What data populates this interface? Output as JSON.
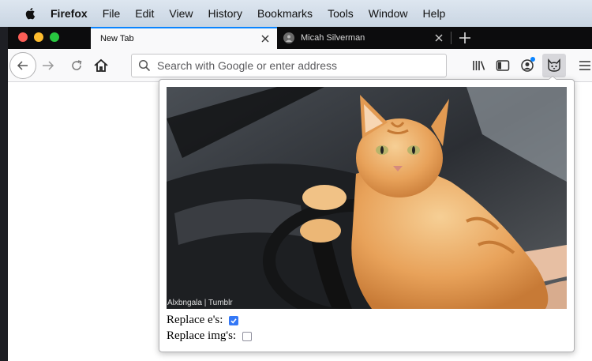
{
  "menubar": {
    "app_name": "Firefox",
    "items": [
      "File",
      "Edit",
      "View",
      "History",
      "Bookmarks",
      "Tools",
      "Window",
      "Help"
    ]
  },
  "tabs": [
    {
      "title": "New Tab",
      "active": true
    },
    {
      "title": "Micah Silverman",
      "active": false
    }
  ],
  "navbar": {
    "search_placeholder": "Search with Google or enter address"
  },
  "popup": {
    "image_caption": "Alxbngala | Tumblr",
    "options": [
      {
        "label": "Replace e's:",
        "checked": true
      },
      {
        "label": "Replace img's:",
        "checked": false
      }
    ]
  },
  "colors": {
    "accent": "#0a84ff",
    "checkbox_on": "#3478f6",
    "tab_strip": "#0c0c0d"
  }
}
